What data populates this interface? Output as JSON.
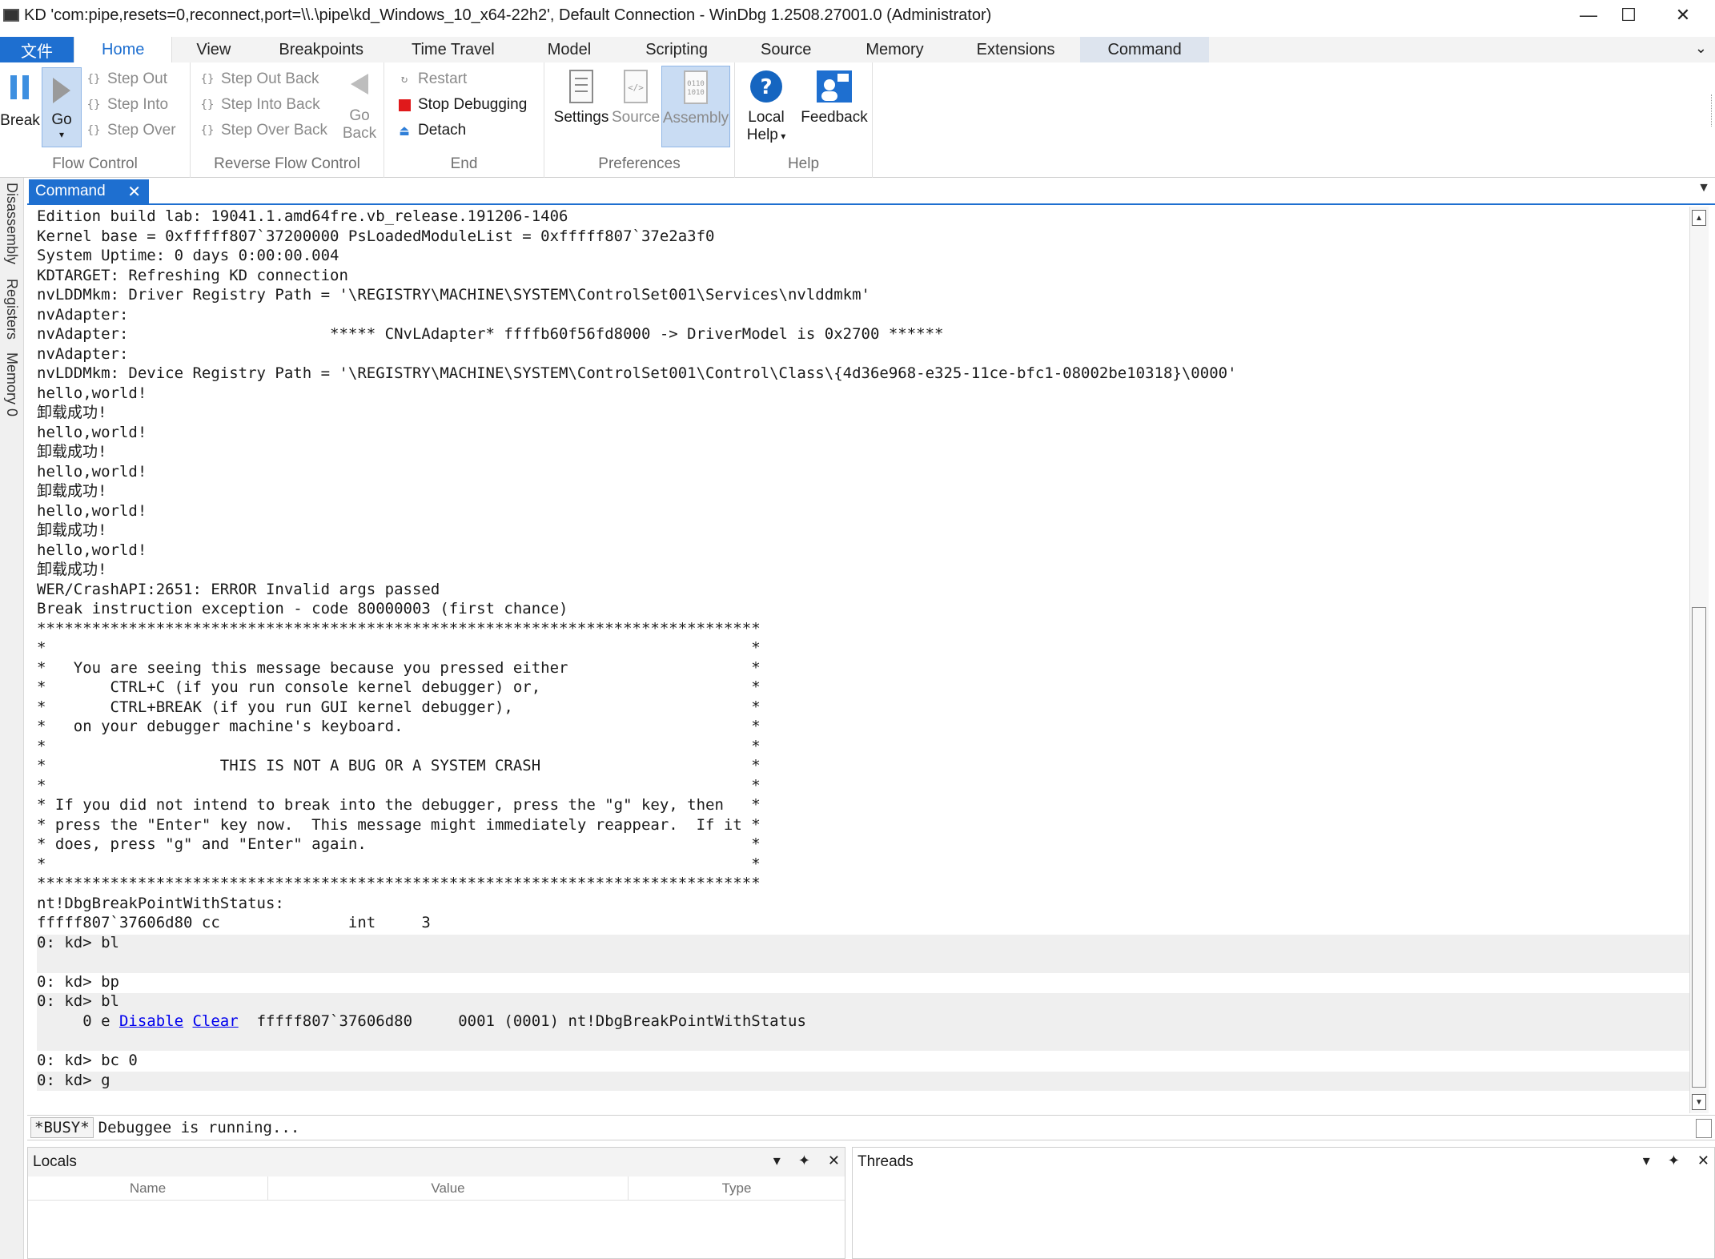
{
  "window": {
    "title": "KD 'com:pipe,resets=0,reconnect,port=\\\\.\\pipe\\kd_Windows_10_x64-22h2', Default Connection  - WinDbg 1.2508.27001.0 (Administrator)",
    "minimize": "—",
    "maximize": "☐",
    "close": "✕"
  },
  "ribbon_tabs": [
    "文件",
    "Home",
    "View",
    "Breakpoints",
    "Time Travel",
    "Model",
    "Scripting",
    "Source",
    "Memory",
    "Extensions",
    "Command"
  ],
  "ribbon": {
    "flow_control": {
      "break": "Break",
      "go": "Go",
      "step_out": "Step Out",
      "step_into": "Step Into",
      "step_over": "Step Over",
      "label": "Flow Control"
    },
    "reverse_flow": {
      "step_out_back": "Step Out Back",
      "step_into_back": "Step Into Back",
      "step_over_back": "Step Over Back",
      "go_back_1": "Go",
      "go_back_2": "Back",
      "label": "Reverse Flow Control"
    },
    "end": {
      "restart": "Restart",
      "stop": "Stop Debugging",
      "detach": "Detach",
      "label": "End"
    },
    "preferences": {
      "settings": "Settings",
      "source": "Source",
      "assembly": "Assembly",
      "label": "Preferences"
    },
    "help": {
      "local_help_1": "Local",
      "local_help_2": "Help",
      "feedback": "Feedback",
      "label": "Help"
    }
  },
  "side_tabs": [
    "Disassembly",
    "Registers",
    "Memory 0"
  ],
  "command_window": {
    "tab_label": "Command",
    "lines": [
      "Edition build lab: 19041.1.amd64fre.vb_release.191206-1406",
      "Kernel base = 0xfffff807`37200000 PsLoadedModuleList = 0xfffff807`37e2a3f0",
      "System Uptime: 0 days 0:00:00.004",
      "KDTARGET: Refreshing KD connection",
      "nvLDDMkm: Driver Registry Path = '\\REGISTRY\\MACHINE\\SYSTEM\\ControlSet001\\Services\\nvlddmkm'",
      "nvAdapter:",
      "nvAdapter:                      ***** CNvLAdapter* ffffb60f56fd8000 -> DriverModel is 0x2700 ******",
      "nvAdapter:",
      "nvLDDMkm: Device Registry Path = '\\REGISTRY\\MACHINE\\SYSTEM\\ControlSet001\\Control\\Class\\{4d36e968-e325-11ce-bfc1-08002be10318}\\0000'",
      "hello,world!",
      "卸载成功!",
      "hello,world!",
      "卸载成功!",
      "hello,world!",
      "卸载成功!",
      "hello,world!",
      "卸载成功!",
      "hello,world!",
      "卸载成功!",
      "WER/CrashAPI:2651: ERROR Invalid args passed",
      "Break instruction exception - code 80000003 (first chance)",
      "*******************************************************************************",
      "*                                                                             *",
      "*   You are seeing this message because you pressed either                    *",
      "*       CTRL+C (if you run console kernel debugger) or,                       *",
      "*       CTRL+BREAK (if you run GUI kernel debugger),                          *",
      "*   on your debugger machine's keyboard.                                      *",
      "*                                                                             *",
      "*                   THIS IS NOT A BUG OR A SYSTEM CRASH                       *",
      "*                                                                             *",
      "* If you did not intend to break into the debugger, press the \"g\" key, then   *",
      "* press the \"Enter\" key now.  This message might immediately reappear.  If it *",
      "* does, press \"g\" and \"Enter\" again.                                          *",
      "*                                                                             *",
      "*******************************************************************************",
      "nt!DbgBreakPointWithStatus:",
      "fffff807`37606d80 cc              int     3",
      "0: kd> bl",
      "",
      "0: kd> bp",
      "0: kd> bl",
      "0: kd> bc 0",
      "0: kd> g"
    ],
    "bp_entry": {
      "prefix": "     0 e ",
      "disable": "Disable",
      "clear": "Clear",
      "rest": "  fffff807`37606d80     0001 (0001) nt!DbgBreakPointWithStatus"
    },
    "busy_label": "*BUSY*",
    "input_value": "Debuggee is running..."
  },
  "locals": {
    "title": "Locals",
    "columns": [
      "Name",
      "Value",
      "Type"
    ]
  },
  "threads": {
    "title": "Threads"
  },
  "colors": {
    "accent": "#1e6fd0",
    "link": "#0000ee",
    "stop_red": "#e0191b",
    "help_blue": "#1565c0"
  }
}
